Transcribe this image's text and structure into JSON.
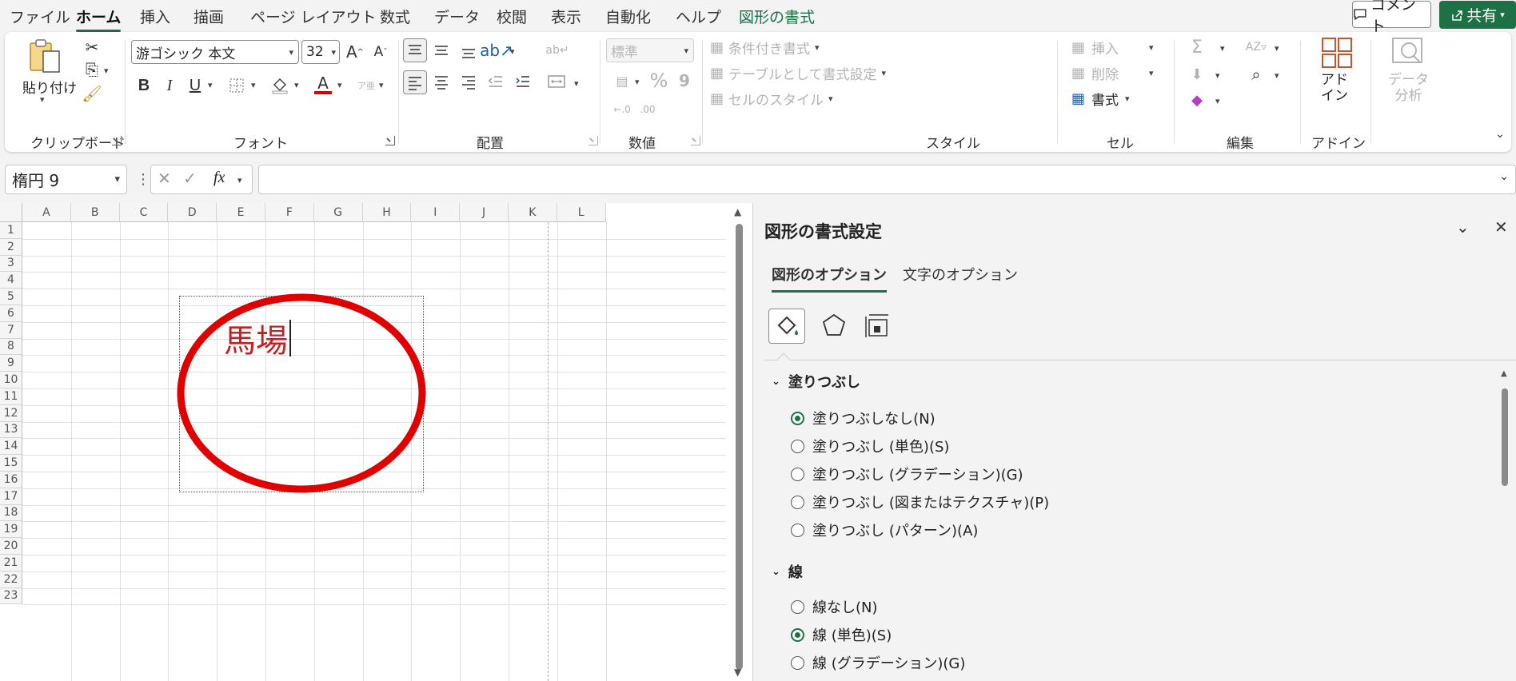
{
  "menu": {
    "tabs": [
      "ファイル",
      "ホーム",
      "挿入",
      "描画",
      "ページ レイアウト",
      "数式",
      "データ",
      "校閲",
      "表示",
      "自動化",
      "ヘルプ",
      "図形の書式"
    ],
    "comment": "コメント",
    "share": "共有"
  },
  "ribbon": {
    "clipboard": {
      "paste": "貼り付け",
      "label": "クリップボード"
    },
    "font": {
      "name": "游ゴシック 本文",
      "size": "32",
      "label": "フォント",
      "bold": "B",
      "italic": "I",
      "underline": "U",
      "grow": "A",
      "shrink": "A",
      "color_letter": "A",
      "phonetic": "ア亜"
    },
    "alignment": {
      "label": "配置"
    },
    "number": {
      "format": "標準",
      "label": "数値",
      "percent": "%",
      "comma": "9",
      "inc_decimal": "←.0",
      "dec_decimal": ".00"
    },
    "styles": {
      "conditional": "条件付き書式",
      "as_table": "テーブルとして書式設定",
      "cell_styles": "セルのスタイル",
      "label": "スタイル"
    },
    "cells": {
      "insert": "挿入",
      "delete": "削除",
      "format": "書式",
      "label": "セル"
    },
    "editing": {
      "label": "編集"
    },
    "addins": {
      "button": "アド\nイン",
      "label": "アドイン"
    },
    "analyze": {
      "button": "データ\n分析"
    }
  },
  "formula_bar": {
    "name_box": "楕円 9",
    "fx": "fx",
    "value": ""
  },
  "grid": {
    "columns": [
      "A",
      "B",
      "C",
      "D",
      "E",
      "F",
      "G",
      "H",
      "I",
      "J",
      "K",
      "L"
    ],
    "rows": [
      "1",
      "2",
      "3",
      "4",
      "5",
      "6",
      "7",
      "8",
      "9",
      "10",
      "11",
      "12",
      "13",
      "14",
      "15",
      "16",
      "17",
      "18",
      "19",
      "20",
      "21",
      "22",
      "23"
    ],
    "shape_text": "馬場",
    "shape_color": "#e00000"
  },
  "pane": {
    "title": "図形の書式設定",
    "tabs": [
      "図形のオプション",
      "文字のオプション"
    ],
    "fill": {
      "heading": "塗りつぶし",
      "options": [
        {
          "label": "塗りつぶしなし(N)",
          "selected": true
        },
        {
          "label": "塗りつぶし (単色)(S)",
          "selected": false
        },
        {
          "label": "塗りつぶし (グラデーション)(G)",
          "selected": false
        },
        {
          "label": "塗りつぶし (図またはテクスチャ)(P)",
          "selected": false
        },
        {
          "label": "塗りつぶし (パターン)(A)",
          "selected": false
        }
      ]
    },
    "line": {
      "heading": "線",
      "options": [
        {
          "label": "線なし(N)",
          "selected": false
        },
        {
          "label": "線 (単色)(S)",
          "selected": true
        },
        {
          "label": "線 (グラデーション)(G)",
          "selected": false
        }
      ]
    }
  },
  "colors": {
    "accent": "#1e7145",
    "shape_red": "#e00000"
  }
}
